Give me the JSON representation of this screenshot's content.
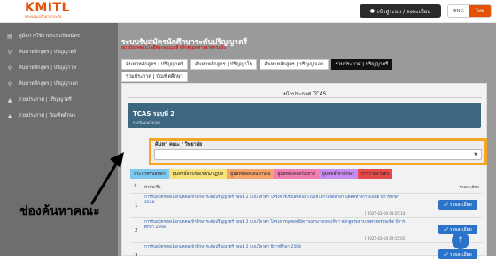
{
  "header": {
    "logo_text": "KMITL",
    "logo_sub": "พระจอมเกล้าลาดกระบัง",
    "login_label": "เข้าสู่ระบบ / ลงทะเบียน",
    "lang": [
      "ENG",
      "ไทย"
    ]
  },
  "sidebar": {
    "items": [
      {
        "label": "คู่มือการใช้งานระบบรับสมัคร",
        "icon": "book-icon"
      },
      {
        "label": "ค้นหาหลักสูตร | ปริญญาตรี",
        "icon": "search-icon"
      },
      {
        "label": "ค้นหาหลักสูตร | ปริญญาโท",
        "icon": "search-icon"
      },
      {
        "label": "ค้นหาหลักสูตร | ปริญญาเอก",
        "icon": "search-icon"
      },
      {
        "label": "รวมประกาศ | ปริญญาตรี",
        "icon": "megaphone-icon"
      },
      {
        "label": "รวมประกาศ | บัณฑิตศึกษา",
        "icon": "megaphone-icon"
      }
    ]
  },
  "main": {
    "title": "ระบบรับสมัครนักศึกษาระดับปริญญาตรี",
    "subtitle": "สถาบันเทคโนโลยีพระจอมเกล้าเจ้าคุณทหารลาดกระบัง",
    "tabs": [
      {
        "label": "ค้นหาหลักสูตร | ปริญญาตรี",
        "active": false
      },
      {
        "label": "ค้นหาหลักสูตร | ปริญญาโท",
        "active": false
      },
      {
        "label": "ค้นหาหลักสูตร | ปริญญาเอก",
        "active": false
      },
      {
        "label": "รวมประกาศ | ปริญญาตรี",
        "active": true
      }
    ],
    "tabs_row2": [
      {
        "label": "รวมประกาศ | บัณฑิตศึกษา"
      }
    ],
    "panel_heading": "หน้าประกาศ TCAS",
    "round_title": "TCAS รอบที่ 2",
    "round_sub": "การรับแบบโควตา",
    "search": {
      "label": "ค้นหา คณะ / วิทยาลัย",
      "placeholder": ""
    },
    "categories": [
      {
        "label": "ประกาศรับสมัคร",
        "color": "#7ec8f0"
      },
      {
        "label": "ผู้มีสิทธิ์สอบข้อเขียน/ปฏิบัติ",
        "color": "#f7e27a"
      },
      {
        "label": "ผู้มีสิทธิ์สอบสัมภาษณ์",
        "color": "#f5a46a"
      },
      {
        "label": "ผู้มีสิทธิ์เคลียริ่งเฮาส์",
        "color": "#f07fb2"
      },
      {
        "label": "ผู้มีสิทธิ์เข้าศึกษา",
        "color": "#c58df0"
      },
      {
        "label": "การรายงานตัว",
        "color": "#e44c4c"
      }
    ],
    "table": {
      "col_no": "#",
      "col_name": "หัวข้อ/ชื่อ",
      "col_detail": "รายละเอียด",
      "rows": [
        {
          "no": "1",
          "text": "การรับสมัครคัดเลือกบุคคลเข้าศึกษาระดับปริญญาตรี รอบที่ 2 แบบโควตา โครงการเรียนดีเด่นทั่วไปให้โอกาสจิตอาสา บุคคลทางการแพทย์ ปีการศึกษา 2568",
          "date": "[ 2025-03-04 09:25:14 ]",
          "btn": "รายละเอียด"
        },
        {
          "no": "2",
          "text": "การรับสมัครคัดเลือกบุคคลเข้าศึกษาระดับปริญญาตรี รอบที่ 2 แบบโควตา โครงการบุคคลที่มีความสามารถทางกีฬา หลักสูตรพยาบาลศาสตรบัณฑิต ปีการศึกษา 2568",
          "date": "[ 2025-03-04 09:15:01 ]",
          "btn": "รายละเอียด"
        },
        {
          "no": "3",
          "text": "การรับสมัครคัดเลือกบุคคลเข้าศึกษาระดับปริญญาตรี รอบที่ 2 แบบโควตา ปีการศึกษา 2568",
          "date": "",
          "btn": "รายละเอียด"
        }
      ]
    }
  },
  "annotation": {
    "callout": "ช่องค้นหาคณะ"
  }
}
